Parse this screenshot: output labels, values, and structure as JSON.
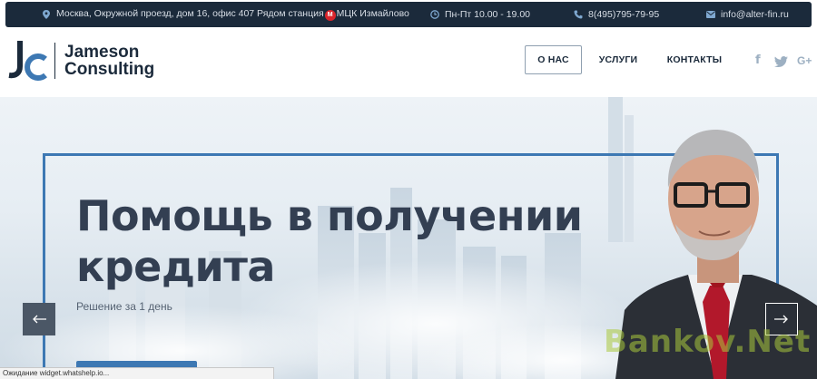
{
  "topbar": {
    "address_prefix": "Москва, Окружной проезд, дом 16, офис 407 Рядом станция",
    "metro_letter": "М",
    "address_suffix": "МЦК Измайлово",
    "hours": "Пн-Пт 10.00 - 19.00",
    "phone": "8(495)795-79-95",
    "email": "info@alter-fin.ru"
  },
  "header": {
    "logo_line1": "Jameson",
    "logo_line2": "Consulting",
    "nav": [
      {
        "label": "О НАС",
        "active": true
      },
      {
        "label": "УСЛУГИ",
        "active": false
      },
      {
        "label": "КОНТАКТЫ",
        "active": false
      }
    ],
    "social": [
      "f",
      "t",
      "G+"
    ]
  },
  "hero": {
    "headline_line1": "Помощь в получении",
    "headline_line2": "кредита",
    "subtext": "Решение за 1 день",
    "watermark": "Bankov.Net"
  },
  "status_bar": "Ожидание widget.whatshelp.io...",
  "colors": {
    "topbar": "#1b2a3b",
    "accent": "#3d78b3",
    "headline": "#333f52"
  }
}
